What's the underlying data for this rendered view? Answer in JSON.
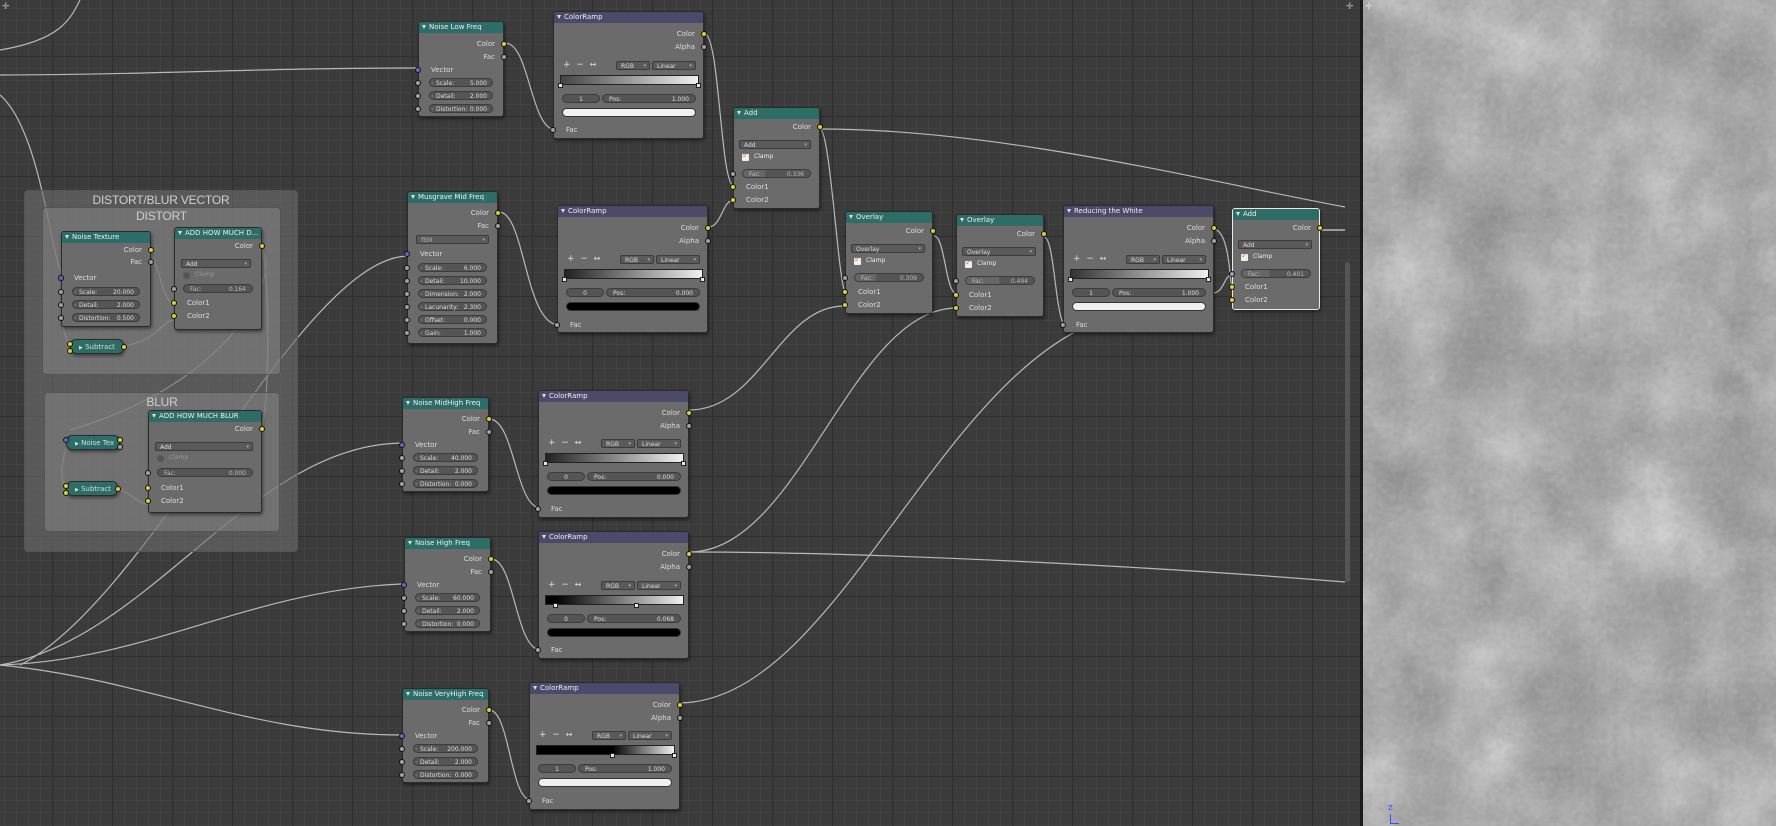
{
  "frames": {
    "distort_blur": "DISTORT/BLUR VECTOR",
    "distort": "DISTORT",
    "blur": "BLUR"
  },
  "labels": {
    "color": "Color",
    "fac": "Fac",
    "vector": "Vector",
    "alpha": "Alpha",
    "color1": "Color1",
    "color2": "Color2",
    "clamp": "Clamp",
    "rgb": "RGB",
    "linear": "Linear",
    "pos": "Pos:"
  },
  "nodes": {
    "noise_texture": {
      "title": "Noise Texture",
      "scale": "Scale:",
      "scale_v": "20.000",
      "detail": "Detail:",
      "detail_v": "2.000",
      "distortion": "Distortion:",
      "distortion_v": "0.500"
    },
    "add_distort": {
      "title": "ADD HOW MUCH D...",
      "blend": "Add",
      "fac": "Fac:",
      "fac_v": "0.164"
    },
    "subtract1": {
      "title": "Subtract"
    },
    "noise_tex_small": {
      "title": "Noise Tex"
    },
    "subtract2": {
      "title": "Subtract"
    },
    "add_blur": {
      "title": "ADD HOW MUCH BLUR",
      "blend": "Add",
      "fac": "Fac:",
      "fac_v": "0.000"
    },
    "noise_low": {
      "title": "Noise Low Freq",
      "scale": "Scale:",
      "scale_v": "5.000",
      "detail": "Detail:",
      "detail_v": "2.000",
      "distortion": "Distortion:",
      "distortion_v": "0.000"
    },
    "musgrave": {
      "title": "Musgrave Mid Freq",
      "type": "fBM",
      "scale": "Scale:",
      "scale_v": "6.000",
      "detail": "Detail:",
      "detail_v": "10.000",
      "dimension": "Dimension:",
      "dimension_v": "2.000",
      "lacunarity": "Lacunarity:",
      "lacunarity_v": "2.300",
      "offset": "Offset:",
      "offset_v": "0.000",
      "gain": "Gain:",
      "gain_v": "1.000"
    },
    "noise_midhigh": {
      "title": "Noise MidHigh Freq",
      "scale": "Scale:",
      "scale_v": "40.000",
      "detail": "Detail:",
      "detail_v": "2.000",
      "distortion": "Distortion:",
      "distortion_v": "0.000"
    },
    "noise_high": {
      "title": "Noise High Freq",
      "scale": "Scale:",
      "scale_v": "60.000",
      "detail": "Detail:",
      "detail_v": "2.000",
      "distortion": "Distortion:",
      "distortion_v": "0.000"
    },
    "noise_veryhigh": {
      "title": "Noise VeryHigh Freq",
      "scale": "Scale:",
      "scale_v": "200.000",
      "detail": "Detail:",
      "detail_v": "2.000",
      "distortion": "Distortion:",
      "distortion_v": "0.000"
    },
    "ramp1": {
      "title": "ColorRamp",
      "index": "1",
      "pos_v": "1.000"
    },
    "ramp2": {
      "title": "ColorRamp",
      "index": "0",
      "pos_v": "0.000"
    },
    "ramp3": {
      "title": "ColorRamp",
      "index": "0",
      "pos_v": "0.000"
    },
    "ramp4": {
      "title": "ColorRamp",
      "index": "0",
      "pos_v": "0.068"
    },
    "ramp5": {
      "title": "ColorRamp",
      "index": "1",
      "pos_v": "1.000"
    },
    "ramp6": {
      "title": "Reducing the White",
      "index": "1",
      "pos_v": "1.000"
    },
    "add1": {
      "title": "Add",
      "blend": "Add",
      "fac": "Fac:",
      "fac_v": "0.336"
    },
    "overlay1": {
      "title": "Overlay",
      "blend": "Overlay",
      "fac": "Fac:",
      "fac_v": "0.309"
    },
    "overlay2": {
      "title": "Overlay",
      "blend": "Overlay",
      "fac": "Fac:",
      "fac_v": "0.494"
    },
    "add2": {
      "title": "Add",
      "blend": "Add",
      "fac": "Fac:",
      "fac_v": "0.401"
    }
  },
  "axis": {
    "z": "Z"
  },
  "icons": [
    "plus-icon",
    "minus-icon",
    "flip-icon",
    "collapse-triangle-icon",
    "checkmark-icon",
    "corner-widget-icon"
  ],
  "colors": {
    "texture_header": "#2c6d6a",
    "converter_header": "#4b4a6a",
    "color_socket": "#d8d032",
    "vector_socket": "#6464c8",
    "value_socket": "#a0a0a0"
  }
}
